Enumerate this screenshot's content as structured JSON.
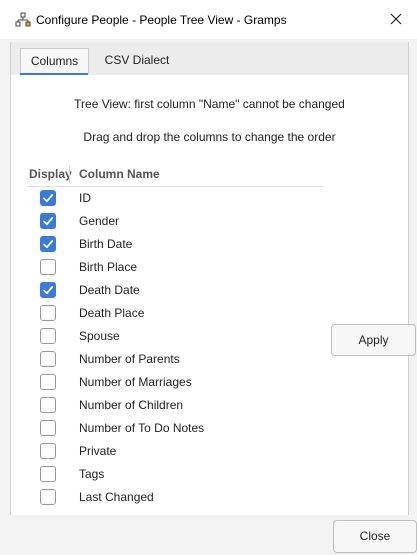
{
  "window": {
    "title": "Configure People - People Tree View - Gramps",
    "app_icon": "tree-icon",
    "close_icon": "close-icon"
  },
  "tabs": [
    {
      "label": "Columns",
      "active": true
    },
    {
      "label": "CSV Dialect",
      "active": false
    }
  ],
  "notes": {
    "line1": "Tree View: first column \"Name\" cannot be changed",
    "line2": "Drag and drop the columns to change the order"
  },
  "table": {
    "headers": {
      "display": "Display",
      "column_name": "Column Name"
    },
    "rows": [
      {
        "label": "ID",
        "checked": true
      },
      {
        "label": "Gender",
        "checked": true
      },
      {
        "label": "Birth Date",
        "checked": true
      },
      {
        "label": "Birth Place",
        "checked": false
      },
      {
        "label": "Death Date",
        "checked": true
      },
      {
        "label": "Death Place",
        "checked": false
      },
      {
        "label": "Spouse",
        "checked": false
      },
      {
        "label": "Number of Parents",
        "checked": false
      },
      {
        "label": "Number of Marriages",
        "checked": false
      },
      {
        "label": "Number of Children",
        "checked": false
      },
      {
        "label": "Number of To Do Notes",
        "checked": false
      },
      {
        "label": "Private",
        "checked": false
      },
      {
        "label": "Tags",
        "checked": false
      },
      {
        "label": "Last Changed",
        "checked": false
      }
    ]
  },
  "buttons": {
    "apply": "Apply",
    "close": "Close"
  },
  "colors": {
    "accent": "#3c7ad9"
  }
}
